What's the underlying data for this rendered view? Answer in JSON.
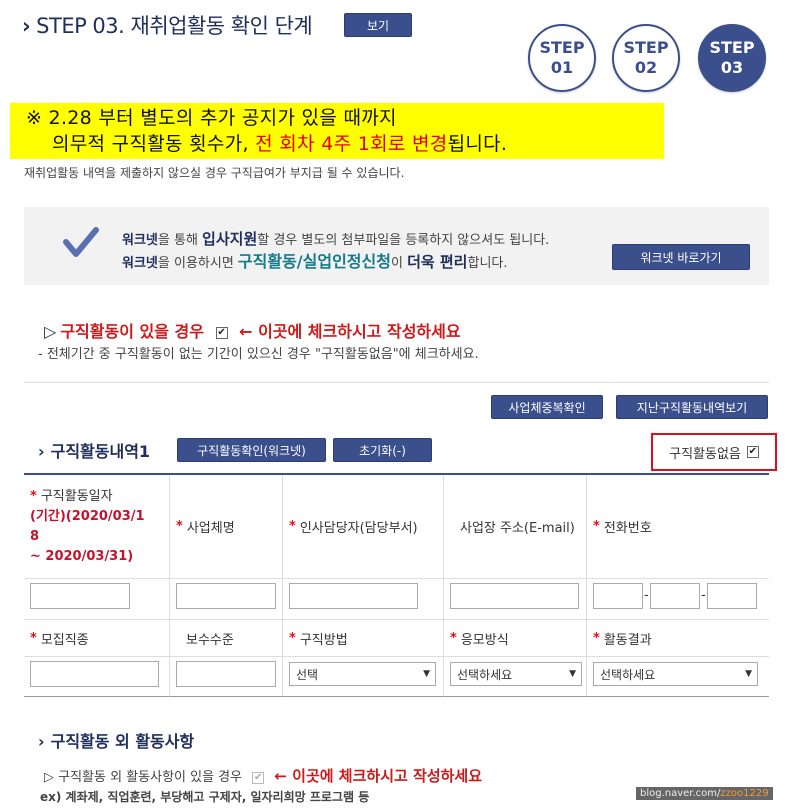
{
  "header": {
    "step_title": "STEP 03. 재취업활동 확인 단계",
    "view_button": "보기",
    "steps": [
      {
        "label": "STEP",
        "num": "01"
      },
      {
        "label": "STEP",
        "num": "02"
      },
      {
        "label": "STEP",
        "num": "03"
      }
    ]
  },
  "notice": {
    "line1": "※ 2.28 부터 별도의 추가 공지가 있을 때까지",
    "line2_a": "의무적 구직활동 횟수가, ",
    "line2_red": "전 회차 4주 1회로 변경",
    "line2_b": "됩니다."
  },
  "subnote": "재취업활동 내역을 제출하지 않으실 경우 구직급여가 부지급 될 수 있습니다.",
  "worknet": {
    "t1a": "워크넷",
    "t1b": "을 통해 ",
    "t1c": "입사지원",
    "t1d": "할 경우 별도의 첨부파일을 등록하지 않으셔도 됩니다.",
    "t2a": "워크넷",
    "t2b": "을 이용하시면 ",
    "t2c": "구직활동/실업인정신청",
    "t2d": "이 ",
    "t2e": "더욱 편리",
    "t2f": "합니다.",
    "button": "워크넷 바로가기"
  },
  "activity": {
    "title_prefix": "▷",
    "title": "구직활동이 있을 경우",
    "checked": "✔",
    "arrow_note": "← 이곳에 체크하시고 작성하세요",
    "sub": "- 전체기간 중 구직활동이 없는 기간이 있으신 경우 \"구직활동없음\"에 체크하세요."
  },
  "buttons": {
    "dup": "사업체중복확인",
    "past": "지난구직활동내역보기",
    "confirm": "구직활동확인(워크넷)",
    "reset": "초기화(-)"
  },
  "history": {
    "title": "구직활동내역1",
    "no_activity": "구직활동없음",
    "checked": "✔"
  },
  "table": {
    "h_date": "구직활동일자",
    "h_date_range1": "(기간)(2020/03/1",
    "h_date_range2": "8",
    "h_date_range3": "~ 2020/03/31)",
    "h_company": "사업체명",
    "h_manager": "인사담당자(담당부서)",
    "h_address": "사업장 주소(E-mail)",
    "h_phone": "전화번호",
    "h_job": "모집직종",
    "h_pay": "보수수준",
    "h_method": "구직방법",
    "h_apply": "응모방식",
    "h_result": "활동결과",
    "sel_method": "선택",
    "sel_apply": "선택하세요",
    "sel_result": "선택하세요",
    "hyphen": "-"
  },
  "other": {
    "title": "구직활동 외 활동사항",
    "sub": "▷ 구직활동 외 활동사항이 있을 경우",
    "checked": "✔",
    "arrow_note": "← 이곳에 체크하시고 작성하세요",
    "example": "ex) 계좌제, 직업훈련, 부당해고 구제자, 일자리희망 프로그램 등"
  },
  "watermark": {
    "prefix": "blog.naver.com/",
    "id": "zzoo1229"
  },
  "colors": {
    "navy": "#3a4f8c",
    "red": "#d9111a",
    "highlight": "#ffff00"
  }
}
